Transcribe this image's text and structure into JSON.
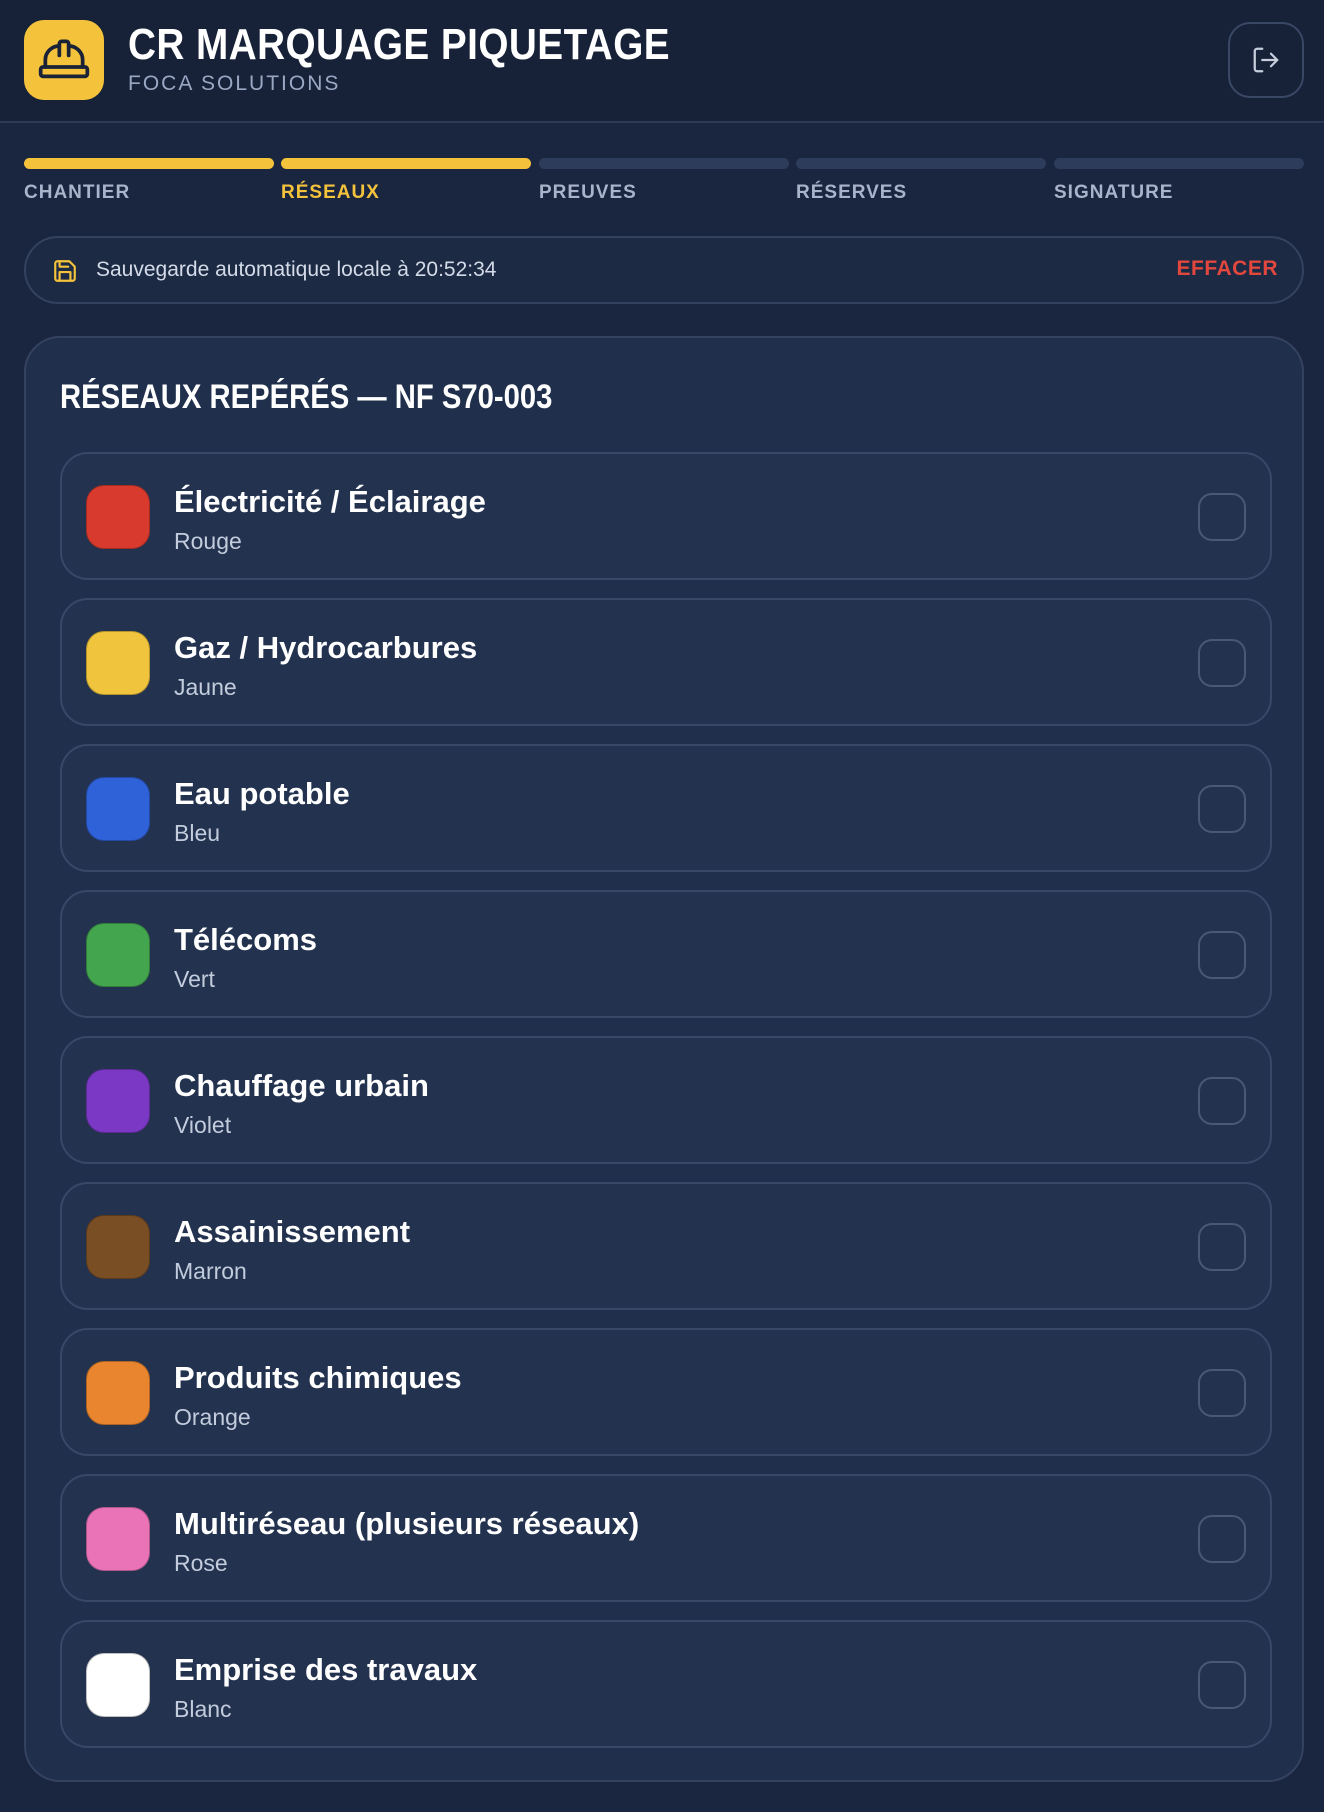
{
  "header": {
    "title": "CR MARQUAGE PIQUETAGE",
    "subtitle": "FOCA SOLUTIONS",
    "logo_icon": "hard-hat-icon",
    "logout_icon": "logout-icon",
    "accent_color": "#f5c33b"
  },
  "steps": [
    {
      "label": "CHANTIER",
      "completed": true,
      "current": false
    },
    {
      "label": "RÉSEAUX",
      "completed": true,
      "current": true
    },
    {
      "label": "PREUVES",
      "completed": false,
      "current": false
    },
    {
      "label": "RÉSERVES",
      "completed": false,
      "current": false
    },
    {
      "label": "SIGNATURE",
      "completed": false,
      "current": false
    }
  ],
  "autosave": {
    "icon": "save-icon",
    "text": "Sauvegarde automatique locale à 20:52:34",
    "clear_label": "EFFACER"
  },
  "networks": {
    "title": "RÉSEAUX REPÉRÉS — NF S70-003",
    "items": [
      {
        "name": "Électricité / Éclairage",
        "color_name": "Rouge",
        "color": "#d83b2e",
        "checked": false
      },
      {
        "name": "Gaz / Hydrocarbures",
        "color_name": "Jaune",
        "color": "#f0c53d",
        "checked": false
      },
      {
        "name": "Eau potable",
        "color_name": "Bleu",
        "color": "#2f62d9",
        "checked": false
      },
      {
        "name": "Télécoms",
        "color_name": "Vert",
        "color": "#43a64e",
        "checked": false
      },
      {
        "name": "Chauffage urbain",
        "color_name": "Violet",
        "color": "#7b38c4",
        "checked": false
      },
      {
        "name": "Assainissement",
        "color_name": "Marron",
        "color": "#7a4e25",
        "checked": false
      },
      {
        "name": "Produits chimiques",
        "color_name": "Orange",
        "color": "#e8852e",
        "checked": false
      },
      {
        "name": "Multiréseau (plusieurs réseaux)",
        "color_name": "Rose",
        "color": "#ea73b7",
        "checked": false
      },
      {
        "name": "Emprise des travaux",
        "color_name": "Blanc",
        "color": "#ffffff",
        "checked": false
      }
    ]
  }
}
